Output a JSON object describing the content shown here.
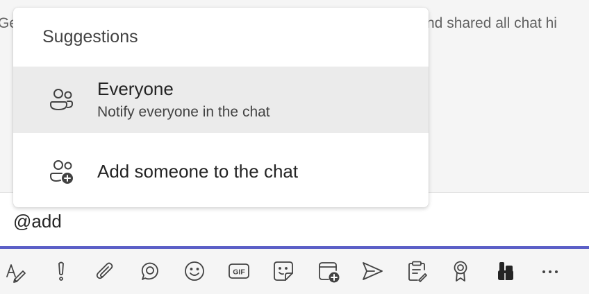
{
  "background": {
    "left_text": "Ge",
    "right_text": "nd shared all chat hi"
  },
  "suggestions_popup": {
    "title": "Suggestions",
    "items": [
      {
        "label": "Everyone",
        "description": "Notify everyone in the chat",
        "icon": "people-icon",
        "highlighted": true
      },
      {
        "label": "Add someone to the chat",
        "description": "",
        "icon": "people-add-icon",
        "highlighted": false
      }
    ]
  },
  "compose": {
    "value": "@add"
  },
  "toolbar": {
    "gif_label": "GIF",
    "items": [
      "format-icon",
      "important-icon",
      "attach-icon",
      "loop-icon",
      "emoji-icon",
      "gif-icon",
      "sticker-icon",
      "schedule-meeting-icon",
      "stream-icon",
      "forms-icon",
      "praise-icon",
      "apps-icon",
      "more-icon"
    ]
  },
  "colors": {
    "accent": "#5b5fc7",
    "highlight": "#ebebeb",
    "text": "#242424",
    "icon": "#424242"
  }
}
